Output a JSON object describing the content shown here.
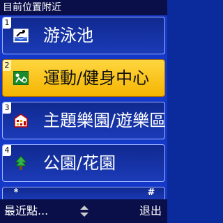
{
  "header": {
    "title": "目前位置附近"
  },
  "items": [
    {
      "num": "1",
      "label": "游泳池",
      "icon": "swimming-pool-icon",
      "selected": false
    },
    {
      "num": "2",
      "label": "運動/健身中心",
      "icon": "fitness-center-icon",
      "selected": true
    },
    {
      "num": "3",
      "label": "主題樂園/遊樂區",
      "icon": "theme-park-icon",
      "selected": false
    },
    {
      "num": "4",
      "label": "公園/花園",
      "icon": "park-tree-icon",
      "selected": false
    }
  ],
  "keys": {
    "star": "*",
    "hash": "#"
  },
  "softkeys": {
    "left": "最近點...",
    "right": "退出"
  },
  "colors": {
    "background": "#1438c8",
    "bar": "#0a0f4a",
    "selected": "#ffd640",
    "item": "#10298f"
  }
}
